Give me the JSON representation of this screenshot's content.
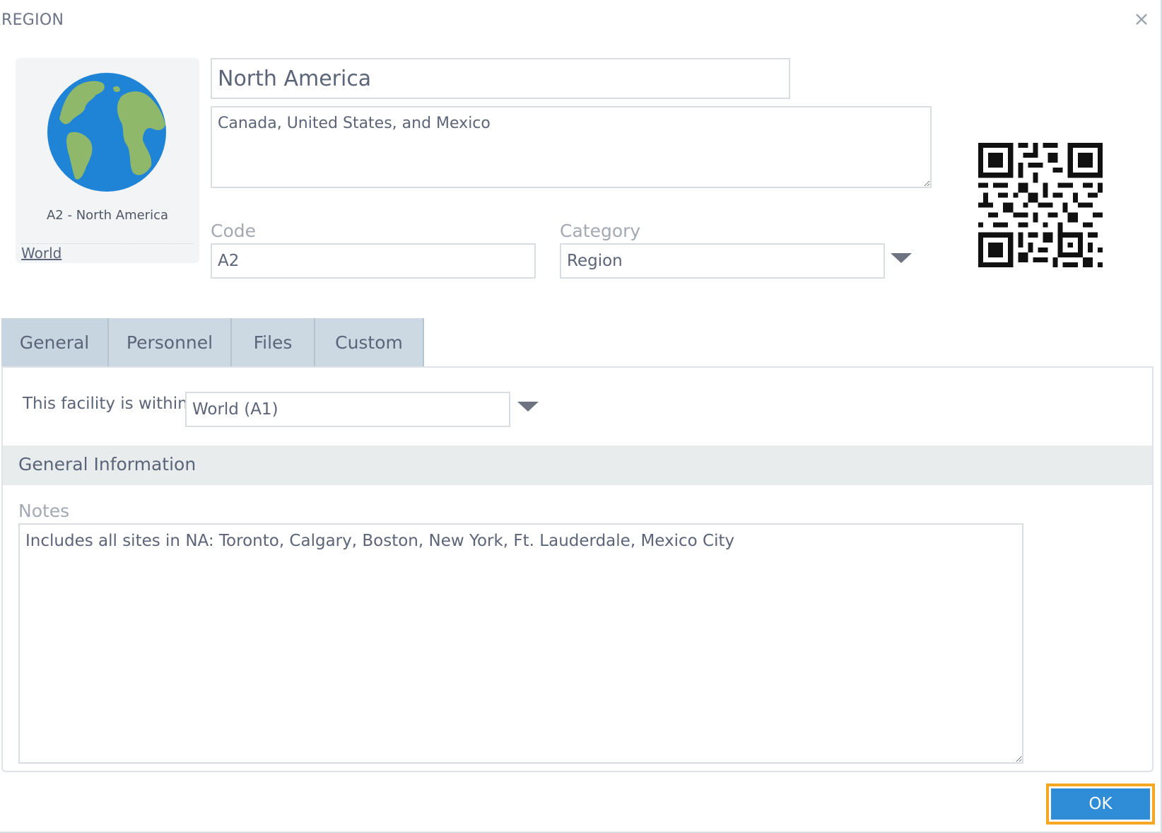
{
  "dialog": {
    "title": "REGION",
    "close_glyph": "×"
  },
  "thumbnail": {
    "icon": "globe-icon",
    "caption": "A2 - North America",
    "parent_link": "World"
  },
  "form": {
    "name": "North America",
    "description": "Canada, United States, and Mexico",
    "code_label": "Code",
    "code_value": "A2",
    "category_label": "Category",
    "category_value": "Region"
  },
  "qr_code": {
    "icon": "qr-code-icon"
  },
  "tabs": [
    {
      "label": "General",
      "active": true
    },
    {
      "label": "Personnel",
      "active": false
    },
    {
      "label": "Files",
      "active": false
    },
    {
      "label": "Custom",
      "active": false
    }
  ],
  "general": {
    "within_label": "This facility is within:",
    "within_value": "World (A1)",
    "section_title": "General Information",
    "notes_label": "Notes",
    "notes_value": "Includes all sites in NA: Toronto, Calgary, Boston, New York, Ft. Lauderdale, Mexico City"
  },
  "footer": {
    "ok_label": "OK"
  },
  "colors": {
    "accent": "#2f8dd8",
    "focus_ring": "#f5a623",
    "tab_bg": "#ccd8e2"
  }
}
